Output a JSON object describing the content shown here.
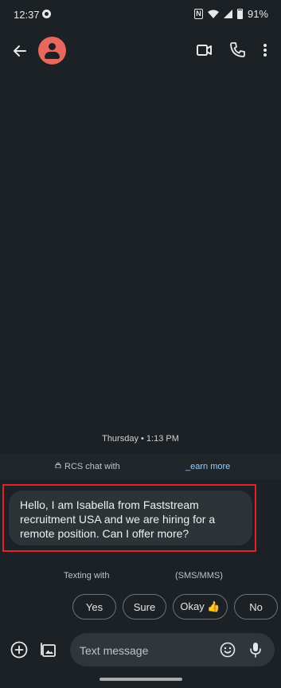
{
  "status_bar": {
    "time": "12:37",
    "battery": "91%"
  },
  "icons": {
    "status": [
      "app-notification-icon",
      "nfc-icon",
      "wifi-icon",
      "signal-icon",
      "battery-icon"
    ],
    "header": [
      "back-arrow-icon",
      "contact-avatar-icon",
      "video-camera-icon",
      "phone-icon",
      "more-vert-icon"
    ],
    "compose": [
      "add-icon",
      "gallery-icon",
      "emoji-icon",
      "mic-icon"
    ]
  },
  "conversation": {
    "timestamp": "Thursday • 1:13 PM",
    "rcs_banner": {
      "text": "RCS chat with",
      "link": "_earn more"
    },
    "messages": [
      {
        "direction": "incoming",
        "text": "Hello, I am Isabella from Faststream recruitment USA and we are hiring for a remote position. Can I offer more?"
      }
    ],
    "texting_with": {
      "left": "Texting with",
      "right": "(SMS/MMS)"
    }
  },
  "smart_replies": [
    "Yes",
    "Sure",
    "Okay 👍",
    "No"
  ],
  "compose": {
    "placeholder": "Text message"
  },
  "colors": {
    "background": "#1c2125",
    "avatar": "#e8685d",
    "highlight": "#e0232b",
    "link": "#9fc8f3",
    "bubble": "#2d3438"
  }
}
